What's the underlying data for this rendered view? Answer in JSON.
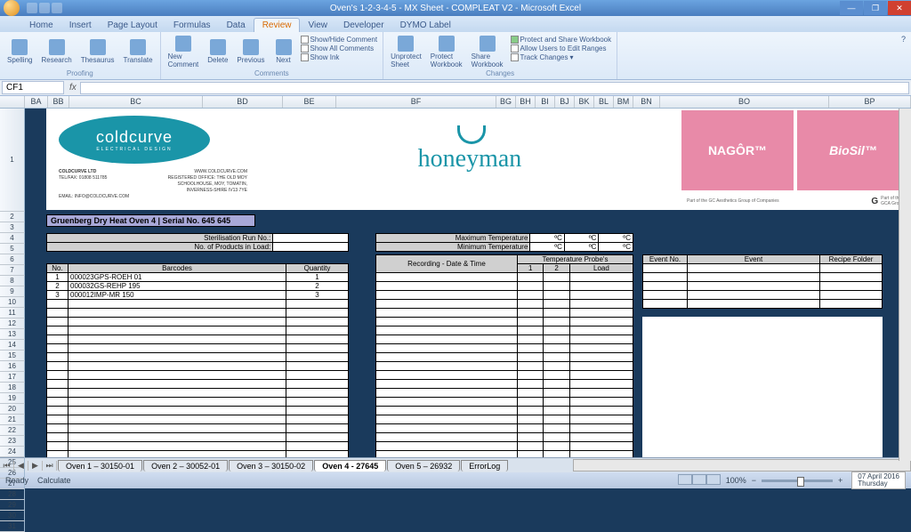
{
  "window": {
    "title": "Oven's 1-2-3-4-5 - MX Sheet - COMPLEAT V2 - Microsoft Excel"
  },
  "tabs": {
    "items": [
      "Home",
      "Insert",
      "Page Layout",
      "Formulas",
      "Data",
      "Review",
      "View",
      "Developer",
      "DYMO Label"
    ],
    "active": "Review"
  },
  "ribbon": {
    "proofing": {
      "label": "Proofing",
      "spelling": "Spelling",
      "research": "Research",
      "thesaurus": "Thesaurus",
      "translate": "Translate"
    },
    "comments": {
      "label": "Comments",
      "new": "New\nComment",
      "delete": "Delete",
      "previous": "Previous",
      "next": "Next",
      "showhide": "Show/Hide Comment",
      "showall": "Show All Comments",
      "showink": "Show Ink"
    },
    "changes": {
      "label": "Changes",
      "unprotect": "Unprotect\nSheet",
      "protectwb": "Protect\nWorkbook",
      "sharewb": "Share\nWorkbook",
      "protectshare": "Protect and Share Workbook",
      "allowedit": "Allow Users to Edit Ranges",
      "track": "Track Changes"
    }
  },
  "formula": {
    "name": "CF1",
    "fx": "fx"
  },
  "cols": [
    "BA",
    "BB",
    "",
    "BC",
    "",
    "BD",
    "",
    "BE",
    "",
    "BF",
    "",
    "",
    "BG",
    "BH",
    "BI",
    "BJ",
    "BK",
    "BL",
    "BM",
    "BN",
    "",
    "BO",
    "",
    "",
    "BP"
  ],
  "logos": {
    "cc": {
      "brand": "coldcurve",
      "sub": "ELECTRICAL DESIGN",
      "company": "COLDCURVE LTD",
      "web": "WWW.COLDCURVE.COM",
      "tel": "TEL/FAX: 01808 511785",
      "email": "EMAIL: INFO@COLDCURVE.COM",
      "addr": "REGISTERED OFFICE: THE OLD MOY SCHOOLHOUSE, MOY, TOMATIN, INVERNESS-SHIRE IV13 7YE"
    },
    "hm": "honeyman",
    "nagor": "NAGÔR™",
    "biosil": "BioSil™",
    "gca": {
      "text": "Part of the GC Aesthetics Group of Companies",
      "badge": "G",
      "sub": "Part of the\nGCA Group"
    }
  },
  "ptitle": "Gruenberg Dry Heat Oven 4  |  Serial No. 645 645",
  "left": {
    "sterRun": "Sterilisation Run No.:",
    "prodLoad": "No. of Products in Load:",
    "hdr": {
      "no": "No.",
      "barcodes": "Barcodes",
      "qty": "Quantity"
    },
    "rows": [
      {
        "no": "1",
        "bc": "000023GPS-ROEH 01",
        "qty": "1"
      },
      {
        "no": "2",
        "bc": "000032GS-REHP 195",
        "qty": "2"
      },
      {
        "no": "3",
        "bc": "000012IMP-MR 150",
        "qty": "3"
      }
    ]
  },
  "mid": {
    "maxT": "Maximum Temperature",
    "minT": "Minimum Temperature",
    "degC": "ºC",
    "probes": "Temperature Probe's",
    "rec": "Recording - Date & Time",
    "p1": "1",
    "p2": "2",
    "load": "Load"
  },
  "rightT": {
    "evno": "Event No.",
    "event": "Event",
    "recipe": "Recipe Folder"
  },
  "sheets": {
    "items": [
      "Oven 1 – 30150-01",
      "Oven 2 – 30052-01",
      "Oven 3 – 30150-02",
      "Oven 4 - 27645",
      "Oven 5 – 26932",
      "ErrorLog"
    ],
    "active": 3
  },
  "status": {
    "ready": "Ready",
    "calc": "Calculate",
    "zoom": "100%",
    "date": "07 April 2016",
    "day": "Thursday"
  }
}
